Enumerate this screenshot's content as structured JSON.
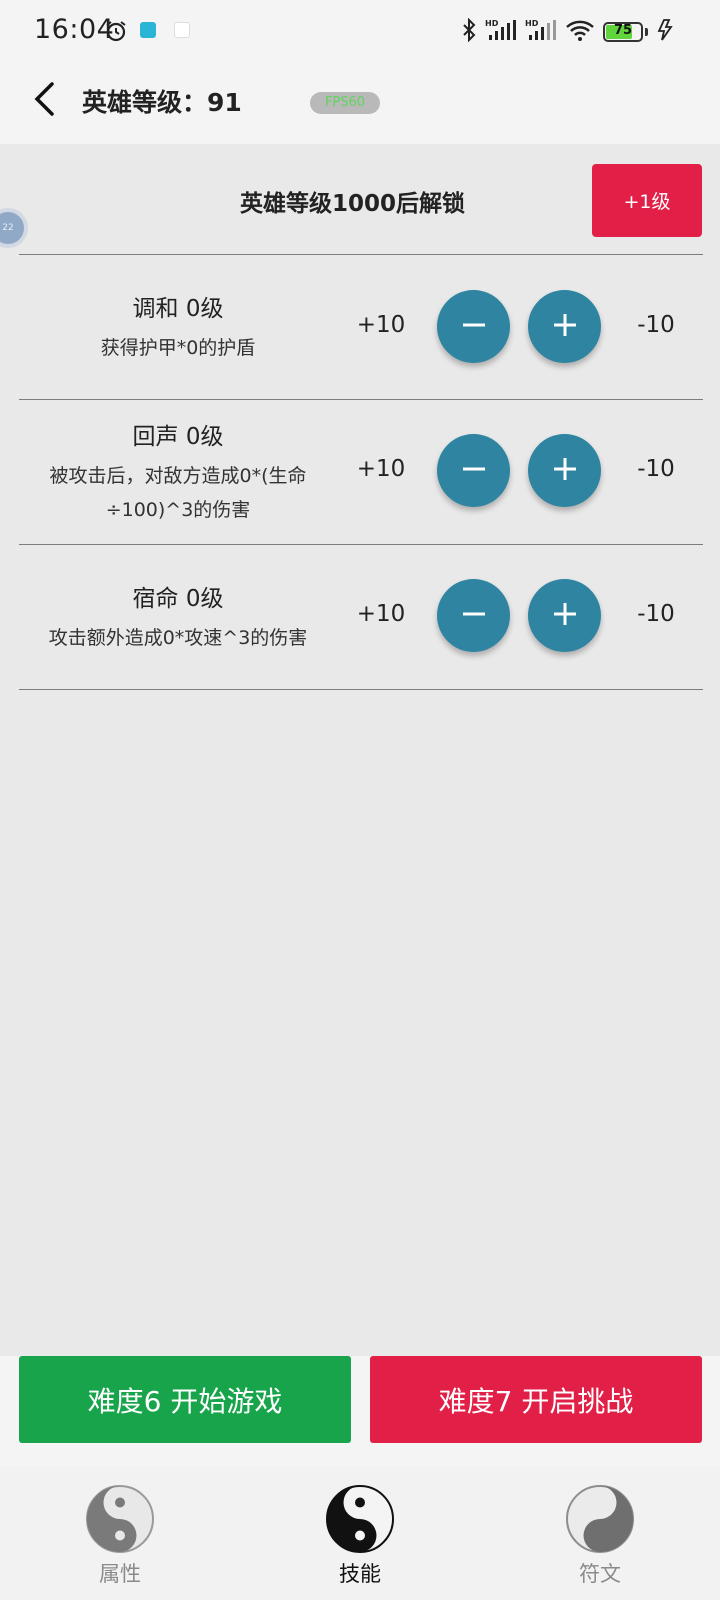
{
  "status_bar": {
    "time": "16:04",
    "battery": "75",
    "battery_level": 0.75,
    "icons": [
      "alarm-icon",
      "app-notification-icon",
      "app-notification-icon",
      "bluetooth-icon",
      "signal-hd-icon",
      "signal-hd-icon",
      "wifi-icon",
      "battery-icon",
      "charging-icon"
    ]
  },
  "header": {
    "title": "英雄等级：91",
    "fps": "FPS60",
    "back_icon": "chevron-left-icon"
  },
  "unlock": {
    "text": "英雄等级1000后解锁",
    "button": "+1级"
  },
  "side_bubble": "22",
  "skills": [
    {
      "name": "调和  0级",
      "desc": "获得护甲*0的护盾",
      "plus": "+10",
      "minus": "-10"
    },
    {
      "name": "回声  0级",
      "desc": "被攻击后，对敌方造成0*(生命÷100)^3的伤害",
      "plus": "+10",
      "minus": "-10"
    },
    {
      "name": "宿命  0级",
      "desc": "攻击额外造成0*攻速^3的伤害",
      "plus": "+10",
      "minus": "-10"
    }
  ],
  "actions": {
    "start": "难度6  开始游戏",
    "challenge": "难度7  开启挑战"
  },
  "nav": [
    {
      "label": "属性",
      "icon": "yin-yang-icon",
      "active": false
    },
    {
      "label": "技能",
      "icon": "yin-yang-icon",
      "active": true
    },
    {
      "label": "符文",
      "icon": "yin-yang-icon",
      "active": false
    }
  ],
  "colors": {
    "accent_red": "#e21f47",
    "accent_green": "#17a44b",
    "button_teal": "#2e84a1"
  }
}
